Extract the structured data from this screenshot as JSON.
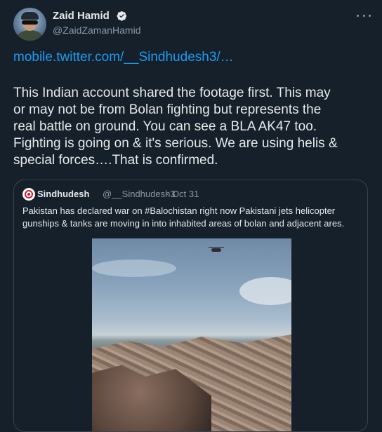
{
  "tweet": {
    "author_name": "Zaid Hamid",
    "author_handle": "@ZaidZamanHamid",
    "link_text": "mobile.twitter.com/__Sindhudesh3/…",
    "text": "This Indian account shared the footage first. This may\nor may not be from Bolan fighting but represents the\nreal battle on ground. You can see a BLA AK47 too.\nFighting is going on & it's serious. We are using helis &\nspecial forces….That is confirmed."
  },
  "quoted": {
    "author_name": "Sindhudesh",
    "author_handle": "@__Sindhudesh3",
    "separator": "·",
    "date": "Oct 31",
    "text": "Pakistan has declared war on #Balochistan right now Pakistani jets helicopter gunships & tanks are moving in into inhabited areas of bolan and adjacent ares."
  },
  "icons": {
    "verified": "verified-badge-icon",
    "more": "more-options-icon"
  },
  "colors": {
    "background": "#15202b",
    "link": "#1d9bf0",
    "muted": "#8b98a5",
    "border": "#38444d"
  }
}
